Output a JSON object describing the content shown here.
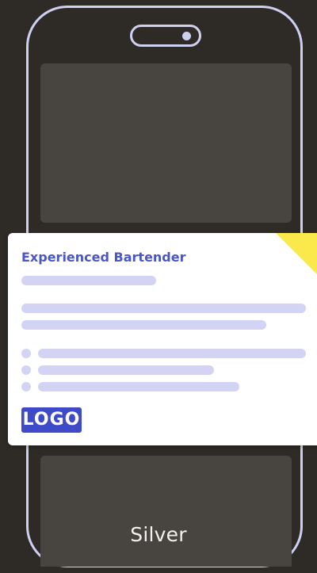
{
  "job_card": {
    "title": "Experienced Bartender",
    "logo_text": "LOGO"
  },
  "device": {
    "model_label": "Silver"
  },
  "colors": {
    "background": "#2e2a25",
    "phone_outline": "#cfd0ef",
    "screen_panel": "#48443f",
    "card_background": "#ffffff",
    "title_accent": "#4a56c6",
    "placeholder_bar": "#d3d4f4",
    "logo_background": "#3f4ac9",
    "corner_flag": "#fbe84a"
  }
}
